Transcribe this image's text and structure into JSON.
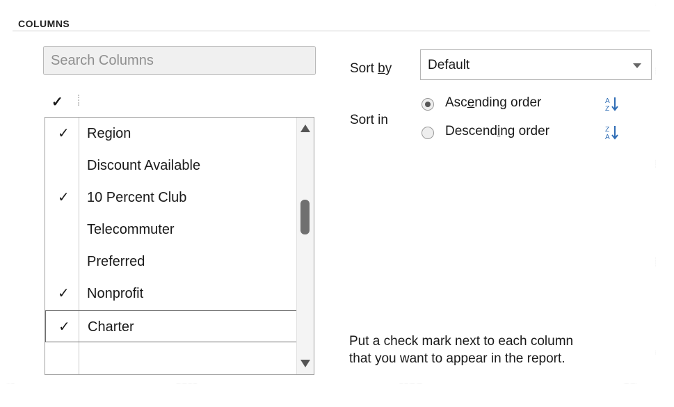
{
  "group": {
    "title": "COLUMNS"
  },
  "search": {
    "placeholder": "Search Columns"
  },
  "header": {
    "check": "✓"
  },
  "columns": [
    {
      "label": "Region",
      "checked": "✓"
    },
    {
      "label": "Discount Available",
      "checked": ""
    },
    {
      "label": "10 Percent Club",
      "checked": "✓"
    },
    {
      "label": "Telecommuter",
      "checked": ""
    },
    {
      "label": "Preferred",
      "checked": ""
    },
    {
      "label": "Nonprofit",
      "checked": "✓"
    },
    {
      "label": "Charter",
      "checked": "✓"
    },
    {
      "label": "",
      "checked": ""
    }
  ],
  "sort": {
    "by_label_pre": "Sort ",
    "by_label_ul": "b",
    "by_label_post": "y",
    "by_value": "Default",
    "in_label": "Sort in",
    "asc_pre": "Asc",
    "asc_ul": "e",
    "asc_post": "nding order",
    "desc_pre": "Descend",
    "desc_ul": "i",
    "desc_post": "ng order",
    "selected": "ascending"
  },
  "help": {
    "line1": "Put a check mark next to each column",
    "line2": "that you want to appear in the report."
  },
  "icons": {
    "asc": "sort-ascending-icon",
    "desc": "sort-descending-icon"
  },
  "colors": {
    "accent": "#2f6db5"
  }
}
